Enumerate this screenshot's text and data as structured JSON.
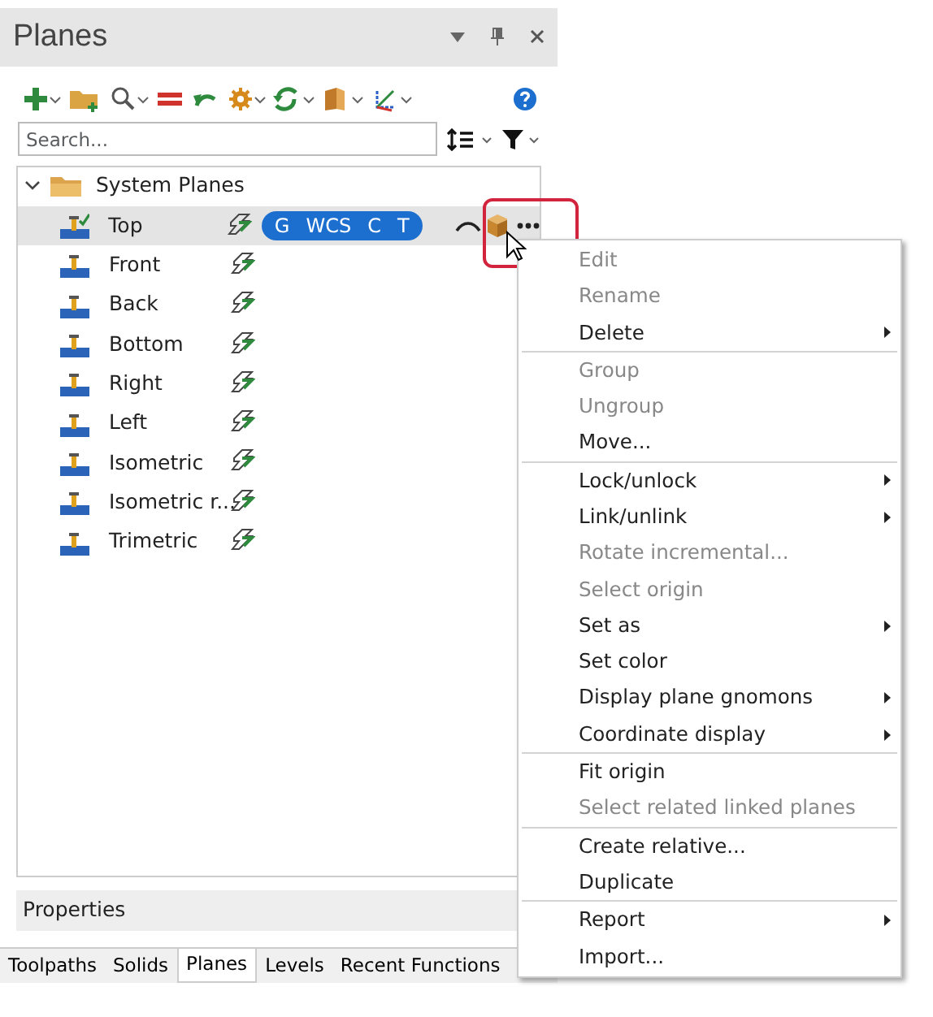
{
  "panel": {
    "title": "Planes"
  },
  "search": {
    "placeholder": "Search..."
  },
  "tree": {
    "label": "System Planes",
    "expanded": true,
    "children": [
      {
        "label": "Top",
        "selected": true,
        "badges": [
          "G",
          "WCS",
          "C",
          "T"
        ]
      },
      {
        "label": "Front",
        "selected": false
      },
      {
        "label": "Back",
        "selected": false
      },
      {
        "label": "Bottom",
        "selected": false
      },
      {
        "label": "Right",
        "selected": false
      },
      {
        "label": "Left",
        "selected": false
      },
      {
        "label": "Isometric",
        "selected": false
      },
      {
        "label": "Isometric r...",
        "selected": false
      },
      {
        "label": "Trimetric",
        "selected": false
      }
    ]
  },
  "properties": {
    "label": "Properties"
  },
  "tabs": [
    {
      "label": "Toolpaths",
      "selected": false
    },
    {
      "label": "Solids",
      "selected": false
    },
    {
      "label": "Planes",
      "selected": true
    },
    {
      "label": "Levels",
      "selected": false
    },
    {
      "label": "Recent Functions",
      "selected": false
    }
  ],
  "context_menu": [
    {
      "kind": "item",
      "label": "Edit",
      "disabled": true,
      "submenu": false
    },
    {
      "kind": "item",
      "label": "Rename",
      "disabled": true,
      "submenu": false
    },
    {
      "kind": "item",
      "label": "Delete",
      "disabled": false,
      "submenu": true
    },
    {
      "kind": "separator"
    },
    {
      "kind": "item",
      "label": "Group",
      "disabled": true,
      "submenu": false
    },
    {
      "kind": "item",
      "label": "Ungroup",
      "disabled": true,
      "submenu": false
    },
    {
      "kind": "item",
      "label": "Move...",
      "disabled": false,
      "submenu": false
    },
    {
      "kind": "separator"
    },
    {
      "kind": "item",
      "label": "Lock/unlock",
      "disabled": false,
      "submenu": true
    },
    {
      "kind": "item",
      "label": "Link/unlink",
      "disabled": false,
      "submenu": true
    },
    {
      "kind": "item",
      "label": "Rotate incremental...",
      "disabled": true,
      "submenu": false
    },
    {
      "kind": "item",
      "label": "Select origin",
      "disabled": true,
      "submenu": false
    },
    {
      "kind": "item",
      "label": "Set as",
      "disabled": false,
      "submenu": true
    },
    {
      "kind": "item",
      "label": "Set color",
      "disabled": false,
      "submenu": false
    },
    {
      "kind": "item",
      "label": "Display plane gnomons",
      "disabled": false,
      "submenu": true
    },
    {
      "kind": "item",
      "label": "Coordinate display",
      "disabled": false,
      "submenu": true
    },
    {
      "kind": "separator"
    },
    {
      "kind": "item",
      "label": "Fit origin",
      "disabled": false,
      "submenu": false
    },
    {
      "kind": "item",
      "label": "Select related linked planes",
      "disabled": true,
      "submenu": false
    },
    {
      "kind": "separator"
    },
    {
      "kind": "item",
      "label": "Create relative...",
      "disabled": false,
      "submenu": false
    },
    {
      "kind": "item",
      "label": "Duplicate",
      "disabled": false,
      "submenu": false
    },
    {
      "kind": "separator"
    },
    {
      "kind": "item",
      "label": "Report",
      "disabled": false,
      "submenu": true
    },
    {
      "kind": "item",
      "label": "Import...",
      "disabled": false,
      "submenu": false
    }
  ]
}
